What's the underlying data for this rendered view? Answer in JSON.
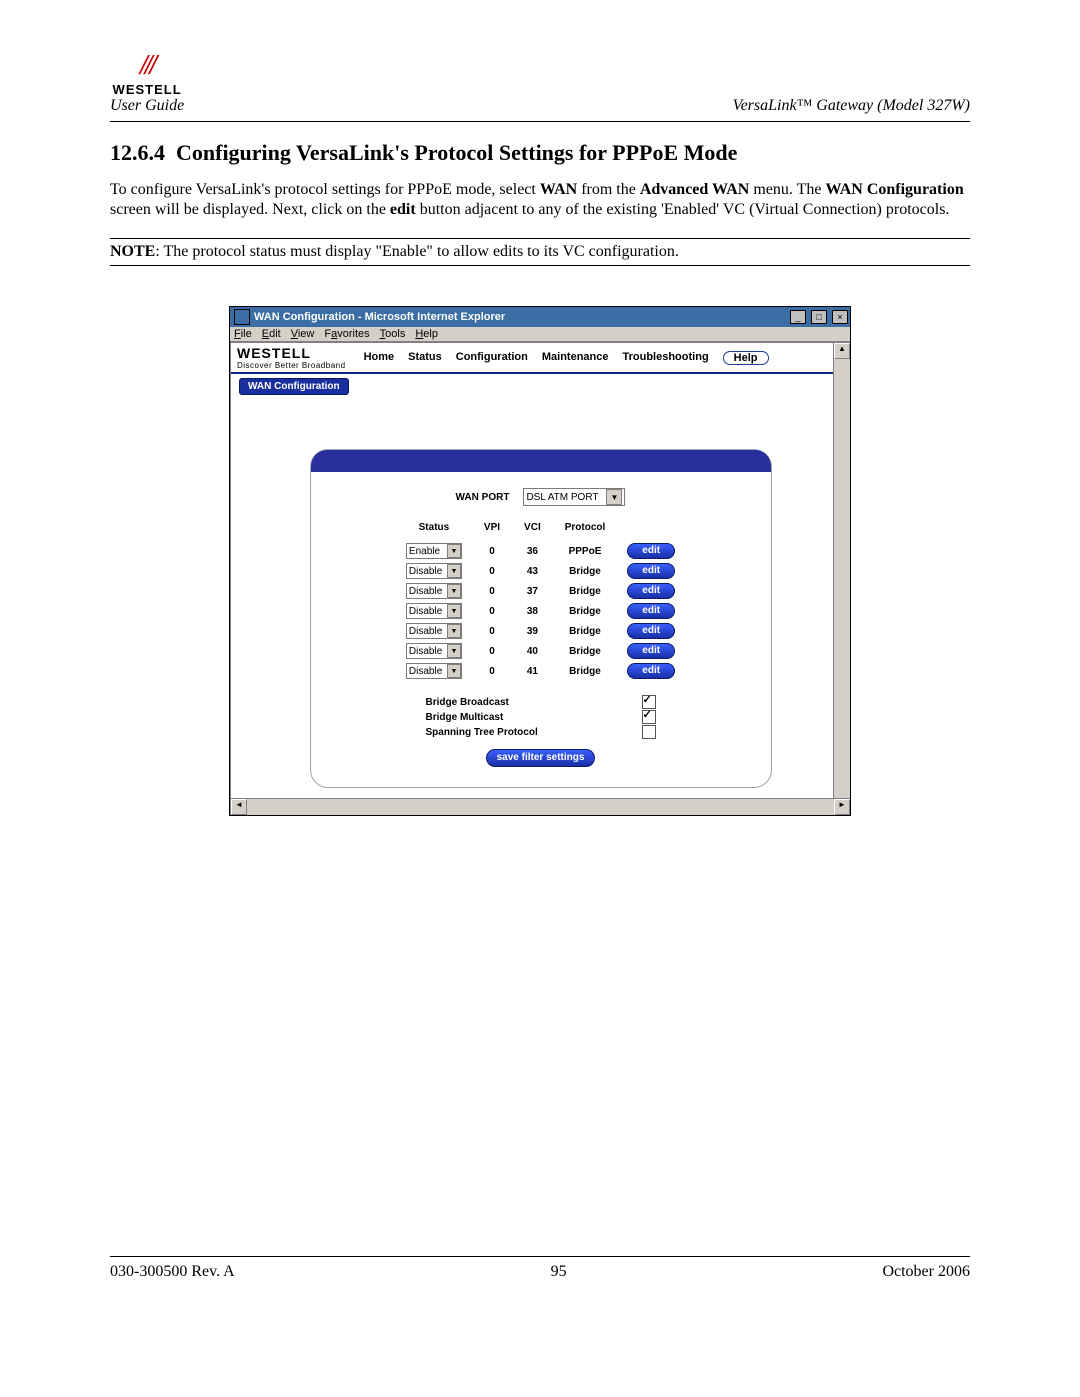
{
  "doc": {
    "logo": "WESTELL",
    "header_left": "User Guide",
    "header_right": "VersaLink™ Gateway (Model 327W)",
    "section_no": "12.6.4",
    "section_title": "Configuring VersaLink's Protocol Settings for PPPoE Mode",
    "para1_a": "To configure VersaLink's protocol settings for PPPoE mode, select ",
    "para1_b": "WAN",
    "para1_c": " from the ",
    "para1_d": "Advanced WAN",
    "para1_e": " menu. The ",
    "para1_f": "WAN Configuration",
    "para1_g": " screen will be displayed. Next, click on the ",
    "para1_h": "edit",
    "para1_i": " button adjacent to any of the existing 'Enabled' VC (Virtual Connection) protocols.",
    "note_label": "NOTE",
    "note_text": ": The protocol status must display \"Enable\" to allow edits to its VC configuration.",
    "footer_left": "030-300500 Rev. A",
    "footer_center": "95",
    "footer_right": "October 2006"
  },
  "ie": {
    "title": "WAN Configuration - Microsoft Internet Explorer",
    "menus": {
      "file": "File",
      "edit": "Edit",
      "view": "View",
      "favorites": "Favorites",
      "tools": "Tools",
      "help": "Help"
    },
    "min": "_",
    "max": "□",
    "close": "×"
  },
  "brand": {
    "name": "WESTELL",
    "tagline": "Discover Better Broadband"
  },
  "nav": {
    "home": "Home",
    "status": "Status",
    "configuration": "Configuration",
    "maintenance": "Maintenance",
    "troubleshooting": "Troubleshooting",
    "help": "Help"
  },
  "breadcrumb": "WAN Configuration",
  "panel": {
    "wanport_label": "WAN PORT",
    "wanport_value": "DSL ATM PORT",
    "cols": {
      "status": "Status",
      "vpi": "VPI",
      "vci": "VCI",
      "protocol": "Protocol"
    },
    "edit_label": "edit",
    "rows": [
      {
        "status": "Enable",
        "vpi": "0",
        "vci": "36",
        "protocol": "PPPoE"
      },
      {
        "status": "Disable",
        "vpi": "0",
        "vci": "43",
        "protocol": "Bridge"
      },
      {
        "status": "Disable",
        "vpi": "0",
        "vci": "37",
        "protocol": "Bridge"
      },
      {
        "status": "Disable",
        "vpi": "0",
        "vci": "38",
        "protocol": "Bridge"
      },
      {
        "status": "Disable",
        "vpi": "0",
        "vci": "39",
        "protocol": "Bridge"
      },
      {
        "status": "Disable",
        "vpi": "0",
        "vci": "40",
        "protocol": "Bridge"
      },
      {
        "status": "Disable",
        "vpi": "0",
        "vci": "41",
        "protocol": "Bridge"
      }
    ],
    "opts": {
      "bridge_broadcast": {
        "label": "Bridge Broadcast",
        "checked": true
      },
      "bridge_multicast": {
        "label": "Bridge Multicast",
        "checked": true
      },
      "spanning_tree": {
        "label": "Spanning Tree Protocol",
        "checked": false
      }
    },
    "save_label": "save filter settings"
  }
}
